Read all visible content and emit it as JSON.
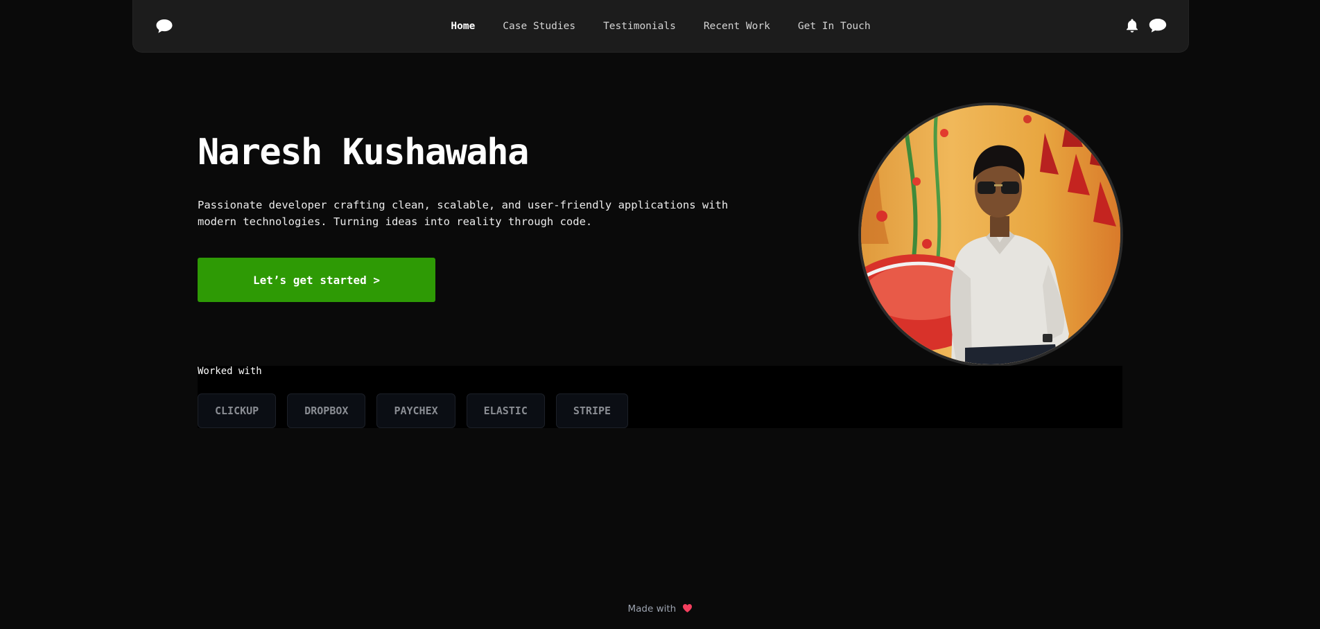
{
  "nav": {
    "links": [
      {
        "label": "Home",
        "active": true
      },
      {
        "label": "Case Studies"
      },
      {
        "label": "Testimonials"
      },
      {
        "label": "Recent Work"
      },
      {
        "label": "Get In Touch"
      }
    ],
    "icons": {
      "logo": "chat-bubble-icon",
      "notifications": "bell-icon",
      "messages": "chat-bubble-icon"
    }
  },
  "hero": {
    "name": "Naresh Kushawaha",
    "description": "Passionate developer crafting clean, scalable, and user-friendly applications with modern technologies. Turning ideas into reality through code.",
    "cta_label": "Let’s get started >"
  },
  "worked_with": {
    "label": "Worked with",
    "companies": [
      "CLICKUP",
      "DROPBOX",
      "PAYCHEX",
      "ELASTIC",
      "STRIPE"
    ]
  },
  "footer": {
    "text": "Made with",
    "icon": "heart-icon"
  },
  "colors": {
    "background": "#0a0a0a",
    "navbar": "#1c1c1c",
    "accent_green": "#2e9a05",
    "heart": "#f43f5e"
  }
}
